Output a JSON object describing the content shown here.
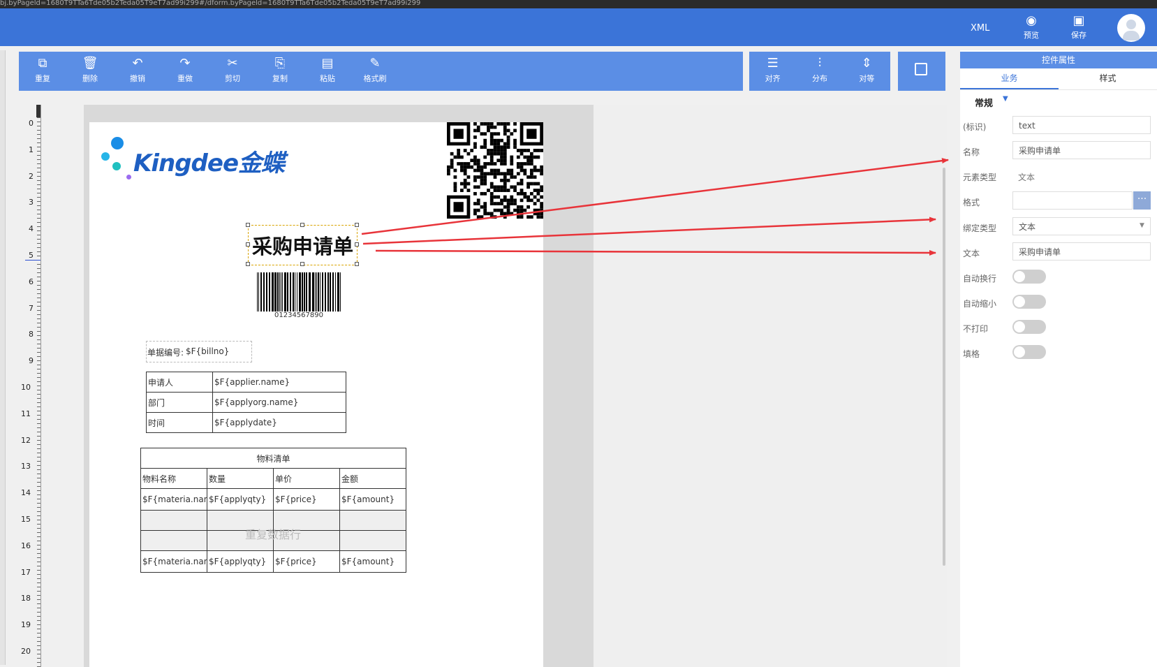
{
  "browser": {
    "url": "bj.byPageld=1680T9TTa6Tde05b2Teda05T9eT7ad99i299#/dform.byPageld=1680T9TTa6Tde05b2Teda05T9eT7ad99i299"
  },
  "header": {
    "xml_label": "XML",
    "preview_label": "预览",
    "save_label": "保存"
  },
  "toolbar": {
    "buttons": [
      {
        "label": "重复",
        "icon": "duplicate-icon"
      },
      {
        "label": "删除",
        "icon": "trash-icon"
      },
      {
        "label": "撤销",
        "icon": "undo-icon"
      },
      {
        "label": "重做",
        "icon": "redo-icon"
      },
      {
        "label": "剪切",
        "icon": "cut-icon"
      },
      {
        "label": "复制",
        "icon": "copy-icon"
      },
      {
        "label": "粘贴",
        "icon": "paste-icon"
      },
      {
        "label": "格式刷",
        "icon": "format-brush-icon"
      }
    ],
    "arrange": [
      {
        "label": "对齐",
        "icon": "align-icon"
      },
      {
        "label": "分布",
        "icon": "distribute-icon"
      },
      {
        "label": "对等",
        "icon": "equal-size-icon"
      }
    ]
  },
  "ruler": {
    "numbers": [
      "0",
      "1",
      "2",
      "3",
      "4",
      "5",
      "6",
      "7",
      "8",
      "9",
      "10",
      "11",
      "12",
      "13",
      "14",
      "15",
      "16",
      "17",
      "18",
      "19",
      "20"
    ]
  },
  "document": {
    "logo_text": "Kingdee金蝶",
    "title": "采购申请单",
    "barcode_number": "01234567890",
    "bill_label": "单据编号:",
    "bill_value": "$F{billno}",
    "info_rows": [
      {
        "label": "申请人",
        "value": "$F{applier.name}"
      },
      {
        "label": "部门",
        "value": "$F{applyorg.name}"
      },
      {
        "label": "时间",
        "value": "$F{applydate}"
      }
    ],
    "material_table": {
      "title": "物料清单",
      "headers": [
        "物料名称",
        "数量",
        "单价",
        "金额"
      ],
      "row": [
        "$F{materia.name}",
        "$F{applyqty}",
        "$F{price}",
        "$F{amount}"
      ],
      "repeat_label": "重复数据行"
    }
  },
  "panel": {
    "title": "控件属性",
    "tabs": [
      "业务",
      "样式"
    ],
    "section": "常规",
    "fields": {
      "id_label": "(标识)",
      "id_value": "text",
      "name_label": "名称",
      "name_value": "采购申请单",
      "element_type_label": "元素类型",
      "element_type_value": "文本",
      "format_label": "格式",
      "format_value": "",
      "bind_type_label": "绑定类型",
      "bind_type_value": "文本",
      "text_label": "文本",
      "text_value": "采购申请单"
    },
    "toggles": [
      {
        "label": "自动换行",
        "on": false
      },
      {
        "label": "自动缩小",
        "on": false
      },
      {
        "label": "不打印",
        "on": false
      },
      {
        "label": "填格",
        "on": false
      }
    ]
  },
  "colors": {
    "header": "#3b74d8",
    "toolbar": "#5b8ee5",
    "arrow": "#e8343a",
    "selection": "#d9a400"
  }
}
